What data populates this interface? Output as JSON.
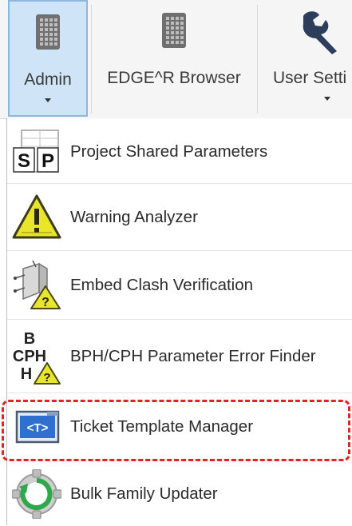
{
  "ribbon": {
    "buttons": [
      {
        "label": "Admin",
        "active": true,
        "icon": "grid-panel-icon"
      },
      {
        "label": "EDGE^R Browser",
        "active": false,
        "icon": "grid-panel-icon"
      },
      {
        "label": "User Setti",
        "active": false,
        "icon": "wrench-icon"
      }
    ]
  },
  "menu": {
    "items": [
      {
        "label": "Project Shared Parameters",
        "icon": "shared-parameters-icon",
        "icon_text": [
          "S",
          "P"
        ]
      },
      {
        "label": "Warning Analyzer",
        "icon": "warning-triangle-icon"
      },
      {
        "label": "Embed Clash Verification",
        "icon": "clash-cube-icon",
        "icon_text": [
          "?"
        ]
      },
      {
        "label": "BPH/CPH Parameter Error Finder",
        "icon": "bph-cph-icon",
        "icon_text": [
          "B",
          "CPH",
          "H",
          "?"
        ]
      },
      {
        "label": "Ticket Template Manager",
        "icon": "ticket-template-icon",
        "icon_text": [
          "<T>"
        ],
        "highlighted": true
      },
      {
        "label": "Bulk Family Updater",
        "icon": "gear-refresh-icon"
      }
    ]
  },
  "colors": {
    "active_bg": "#cfe4f6",
    "highlight": "#e02424",
    "warning_yellow": "#e8e52a"
  }
}
